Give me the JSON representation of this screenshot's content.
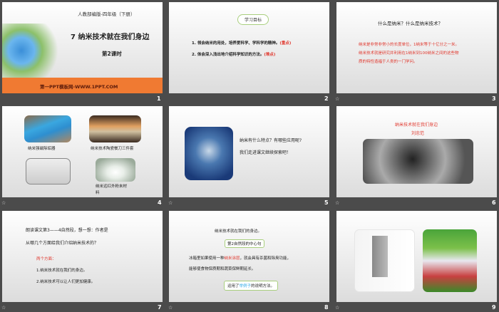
{
  "slides": [
    {
      "number": "1",
      "edition": "人教部编版-四年级（下册）",
      "title": "7 纳米技术就在我们身边",
      "lesson": "第2课时",
      "footer": "第一PPT模板网-WWW.1PPT.COM"
    },
    {
      "number": "2",
      "badge": "学习目标",
      "items": [
        {
          "text": "1. 领会纳米的用处，培养爱科学、学科学的精神。",
          "tag": "(重点)"
        },
        {
          "text": "2. 体会深入浅出地介绍科学知识的方法。",
          "tag": "(难点)"
        }
      ]
    },
    {
      "number": "3",
      "question": "什么是纳米？什么是纳米技术？",
      "lines": [
        "纳米是非常非常小的长度单位，1纳米等于十亿分之一米。",
        "纳米技术就是研究并利用在1纳米到100纳米之间的这些物",
        "质的特性造福于人类的一门学问。"
      ]
    },
    {
      "number": "4",
      "captions": [
        "纳米强磁除垢器",
        "纳米技术陶瓷餐刀三件套",
        "纳米远红外粉末材",
        "料"
      ]
    },
    {
      "number": "5",
      "lines": [
        "纳米有什么特点？有哪些应用呢?",
        "我们走进课文继续探索吧！"
      ]
    },
    {
      "number": "6",
      "title": "纳米技术就在我们身边",
      "author": "刘忠范"
    },
    {
      "number": "7",
      "lines": [
        "朗读课文第3——4自然段，想一想：作者是",
        "从哪几个方面给我们介绍纳米技术的？"
      ],
      "heading": "两个方面：",
      "points": [
        "1.纳米技术就在我们的身边。",
        "2.纳米技术可以让人们更加健康。"
      ]
    },
    {
      "number": "8",
      "line1": "纳米技术就在我们的身边。",
      "callout": "第2自然段的中心句",
      "para_a": "冰箱里如果使用一种",
      "para_highlight": "纳米涂层",
      "para_b": "，就会具有杀菌和除臭功能，",
      "para2": "能够使食物保质期和蔬菜保鲜期延长。",
      "note_a": "运用了",
      "note_highlight": "举例子",
      "note_b": "的说明方法。"
    },
    {
      "number": "9"
    }
  ],
  "colors": {
    "background": "#4b4b4b",
    "accent_red": "#e0392f",
    "orange": "#f07a32",
    "green_border": "#a9cf7e",
    "blue_link": "#2aa7e6"
  }
}
